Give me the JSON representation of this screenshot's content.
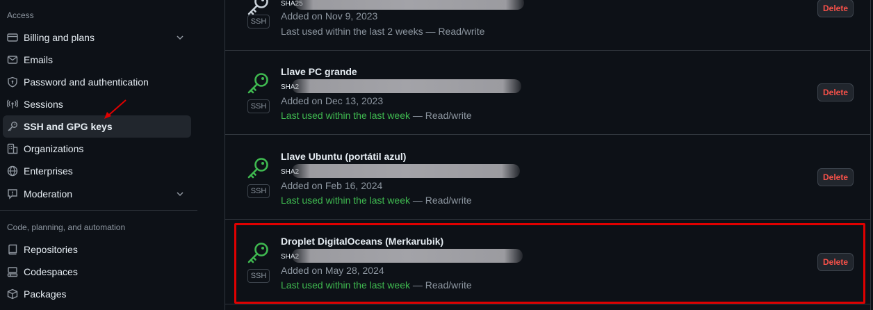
{
  "sidebar": {
    "access_heading": "Access",
    "code_heading": "Code, planning, and automation",
    "items": [
      {
        "label": "Billing and plans",
        "icon": "credit-card-icon",
        "chevron": true
      },
      {
        "label": "Emails",
        "icon": "mail-icon"
      },
      {
        "label": "Password and authentication",
        "icon": "shield-lock-icon"
      },
      {
        "label": "Sessions",
        "icon": "broadcast-icon"
      },
      {
        "label": "SSH and GPG keys",
        "icon": "key-icon",
        "active": true
      },
      {
        "label": "Organizations",
        "icon": "organization-icon"
      },
      {
        "label": "Enterprises",
        "icon": "globe-icon"
      },
      {
        "label": "Moderation",
        "icon": "report-icon",
        "chevron": true
      },
      {
        "label": "Repositories",
        "icon": "repo-icon"
      },
      {
        "label": "Codespaces",
        "icon": "codespaces-icon"
      },
      {
        "label": "Packages",
        "icon": "package-icon"
      }
    ]
  },
  "keys": [
    {
      "title": "",
      "fingerprint_prefix": "SHA25",
      "badge": "SSH",
      "added": "Added on Nov 9, 2023",
      "last_used_recent": "",
      "last_used": "Last used within the last 2 weeks — Read/write",
      "delete_label": "Delete"
    },
    {
      "title": "Llave PC grande",
      "fingerprint_prefix": "SHA2",
      "badge": "SSH",
      "added": "Added on Dec 13, 2023",
      "last_used_recent": "Last used within the last week",
      "last_used": " — Read/write",
      "delete_label": "Delete"
    },
    {
      "title": "Llave Ubuntu (portátil azul)",
      "fingerprint_prefix": "SHA2",
      "badge": "SSH",
      "added": "Added on Feb 16, 2024",
      "last_used_recent": "Last used within the last week",
      "last_used": " — Read/write",
      "delete_label": "Delete"
    },
    {
      "title": "Droplet DigitalOceans (Merkarubik)",
      "fingerprint_prefix": "SHA2",
      "badge": "SSH",
      "added": "Added on May 28, 2024",
      "last_used_recent": "Last used within the last week",
      "last_used": " — Read/write",
      "delete_label": "Delete"
    }
  ],
  "colors": {
    "background": "#0d1117",
    "key_icon": "#3fb950",
    "recent_text": "#3fb950",
    "delete_text": "#f85149",
    "highlight": "#e00000"
  }
}
